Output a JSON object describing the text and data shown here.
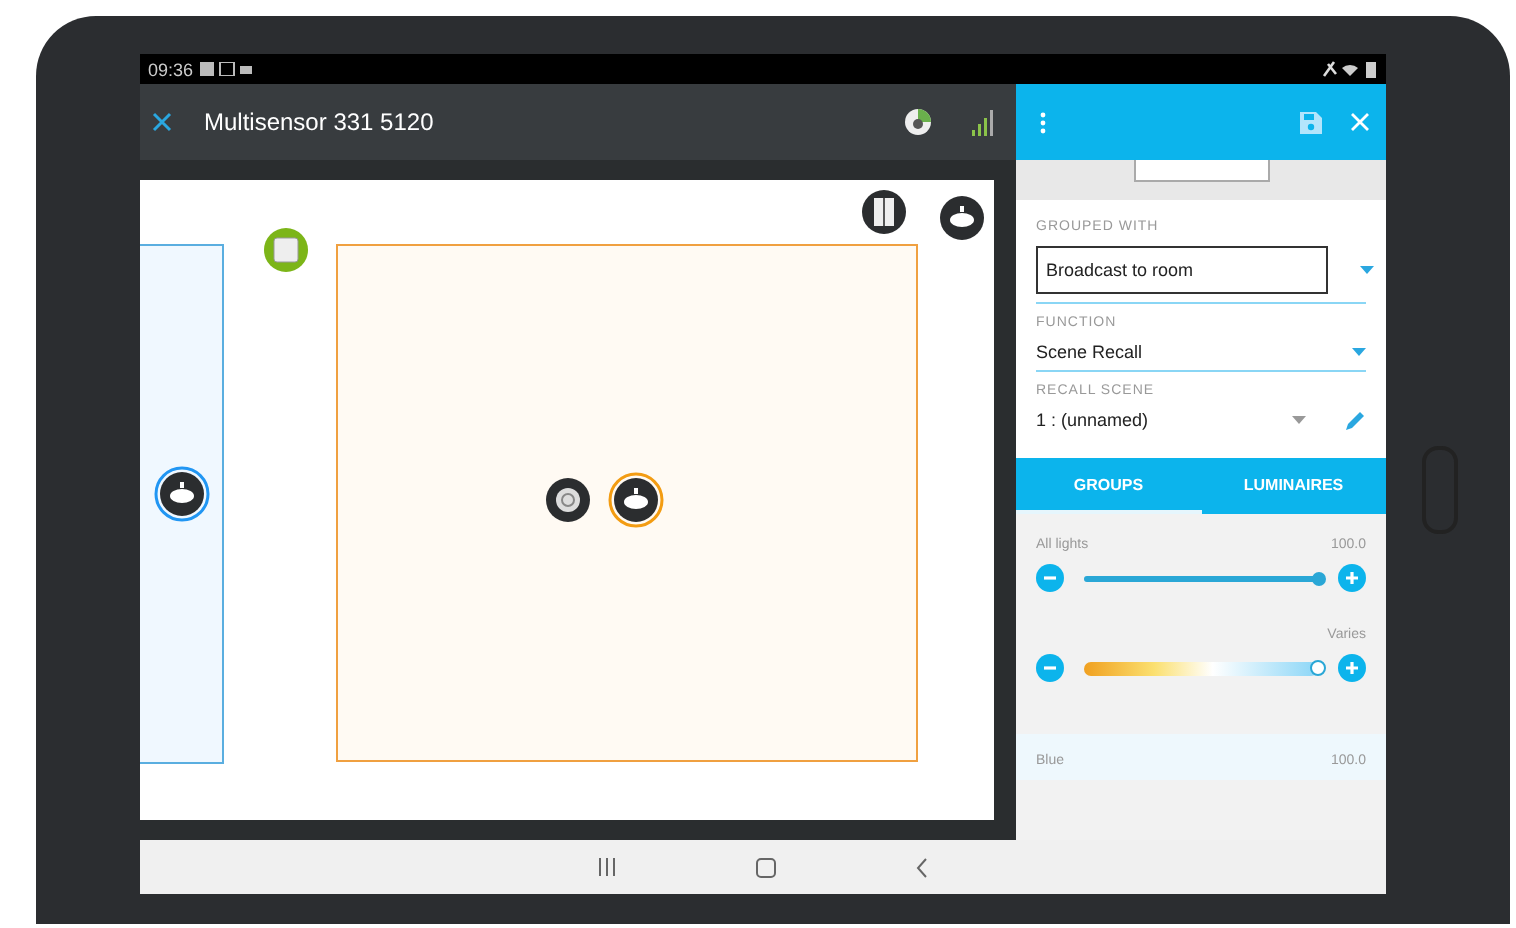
{
  "status_bar": {
    "time": "09:36"
  },
  "toolbar": {
    "title": "Multisensor 331 5120"
  },
  "panel": {
    "fields": [
      {
        "kind": "outlined",
        "label": "GROUPED WITH",
        "value": "Broadcast to room"
      },
      {
        "kind": "underlined",
        "label": "FUNCTION",
        "value": "Scene Recall"
      },
      {
        "kind": "editable",
        "label": "RECALL SCENE",
        "value": "1 : (unnamed)"
      }
    ],
    "tabs": [
      {
        "label": "GROUPS",
        "selected": true
      },
      {
        "label": "LUMINAIRES",
        "selected": false
      }
    ],
    "controls": [
      {
        "kind": "dimmer",
        "label": "All lights",
        "reading": "100.0",
        "level": 1
      },
      {
        "kind": "temperature",
        "reading": "Varies",
        "level": 1
      },
      {
        "kind": "group-header",
        "label": "Blue",
        "reading": "100.0"
      }
    ]
  }
}
